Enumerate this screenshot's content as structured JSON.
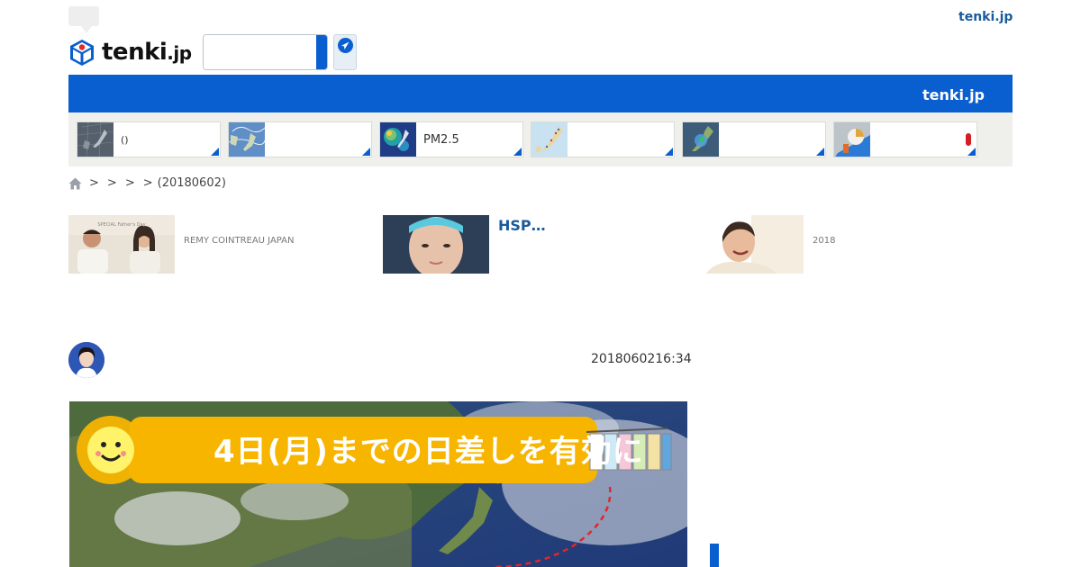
{
  "header": {
    "top_link": "tenki.jp",
    "logo_main": "tenki",
    "logo_suffix": ".jp",
    "search_placeholder": ""
  },
  "navbar": {
    "title": "tenki.jp"
  },
  "map_cards": [
    {
      "label": "()",
      "icon": "japan-map-thumbnail"
    },
    {
      "label": "",
      "icon": "weather-chart-thumbnail"
    },
    {
      "label": "PM2.5",
      "icon": "pm25-map-thumbnail"
    },
    {
      "label": "",
      "icon": "japan-temperature-map-thumbnail"
    },
    {
      "label": "",
      "icon": "radar-map-thumbnail"
    },
    {
      "label": "",
      "icon": "warning-map-thumbnail"
    }
  ],
  "breadcrumb": {
    "separators": [
      ">",
      ">",
      ">",
      ">"
    ],
    "current": "(20180602)"
  },
  "promos": [
    {
      "text": "REMY COINTREAU JAPAN",
      "image": "fathers-day-photo"
    },
    {
      "title": "HSP…",
      "image": "woman-face-photo"
    },
    {
      "text": "2018",
      "image": "smiling-woman-photo"
    }
  ],
  "article": {
    "date": "2018060216:34",
    "hero_text": "4日(月)までの日差しを有効に"
  },
  "colors": {
    "brand_blue": "#0a5fd0",
    "link_blue": "#1a5a9c",
    "map_strip_bg": "#eff0ec",
    "warning_red": "#d51c24",
    "hero_banner": "#f7b500"
  }
}
